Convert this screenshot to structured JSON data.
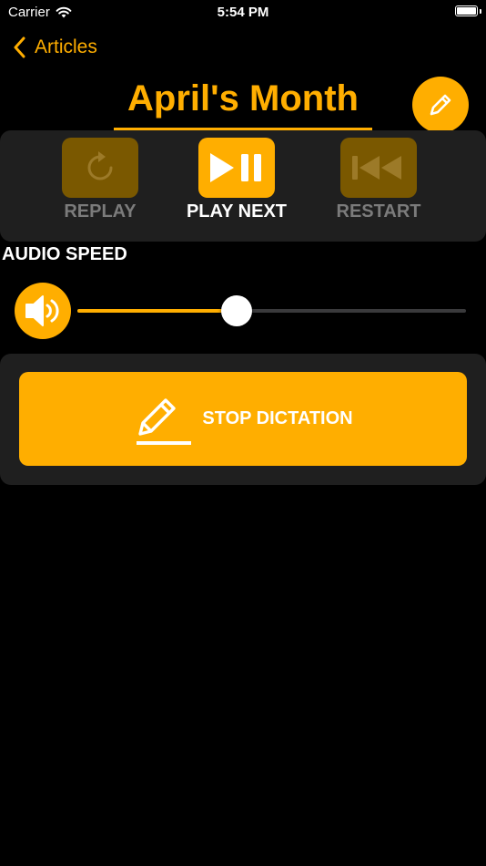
{
  "status_bar": {
    "carrier": "Carrier",
    "time": "5:54 PM"
  },
  "nav": {
    "back_label": "Articles"
  },
  "article": {
    "title": "April's Month"
  },
  "controls": {
    "replay_label": "REPLAY",
    "play_next_label": "PLAY NEXT",
    "restart_label": "RESTART"
  },
  "audio": {
    "label": "AUDIO SPEED",
    "speed_fraction": 0.41
  },
  "dictation": {
    "button_label": "STOP DICTATION"
  },
  "colors": {
    "accent": "#FFAE00",
    "accent_disabled": "#7A5800",
    "panel": "#1F1F1F",
    "background": "#000000"
  }
}
